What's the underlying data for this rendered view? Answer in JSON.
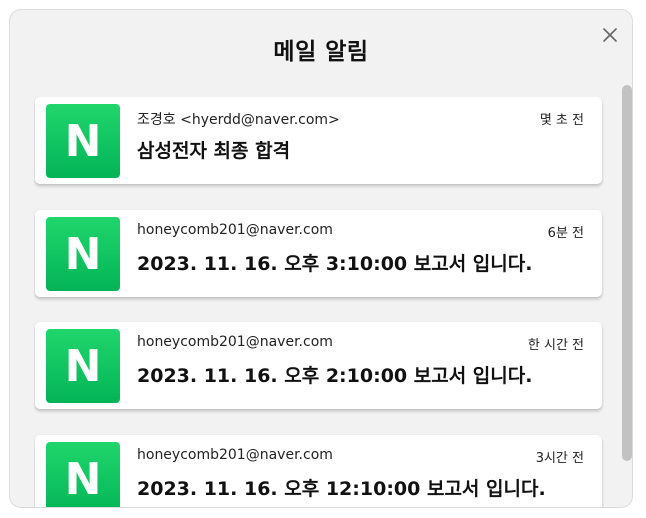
{
  "dialog": {
    "title": "메일 알림",
    "close_icon": "close-icon"
  },
  "notifications": [
    {
      "logo_letter": "N",
      "sender": "조경호 <hyerdd@naver.com>",
      "time": "몇 초 전",
      "subject": "삼성전자 최종 합격"
    },
    {
      "logo_letter": "N",
      "sender": "honeycomb201@naver.com",
      "time": "6분 전",
      "subject": "2023. 11. 16. 오후 3:10:00 보고서 입니다."
    },
    {
      "logo_letter": "N",
      "sender": "honeycomb201@naver.com",
      "time": "한 시간 전",
      "subject": "2023. 11. 16. 오후 2:10:00 보고서 입니다."
    },
    {
      "logo_letter": "N",
      "sender": "honeycomb201@naver.com",
      "time": "3시간 전",
      "subject": "2023. 11. 16. 오후 12:10:00 보고서 입니다."
    }
  ],
  "colors": {
    "brand_green": "#03c75a",
    "background": "#f2f2f2",
    "card": "#ffffff",
    "scrollbar": "#c2c2c2"
  }
}
